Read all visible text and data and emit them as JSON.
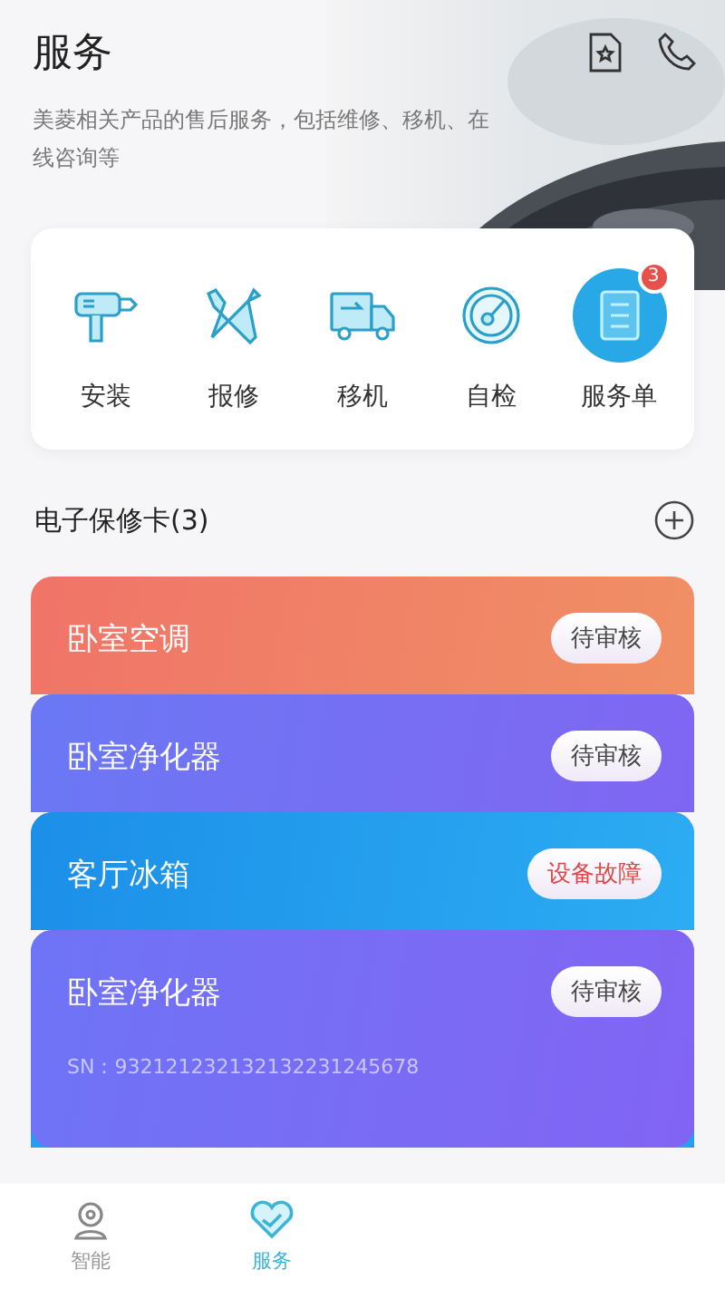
{
  "header": {
    "title": "服务",
    "description": "美菱相关产品的售后服务，包括维修、移机、在线咨询等"
  },
  "services": [
    {
      "kind": "install",
      "label": "安装",
      "highlighted": false
    },
    {
      "kind": "repair",
      "label": "报修",
      "highlighted": false
    },
    {
      "kind": "move",
      "label": "移机",
      "highlighted": false
    },
    {
      "kind": "check",
      "label": "自检",
      "highlighted": false
    },
    {
      "kind": "order",
      "label": "服务单",
      "highlighted": true,
      "badge": "3"
    }
  ],
  "warranty": {
    "title": "电子保修卡(3)",
    "cards": [
      {
        "name": "卧室空调",
        "status": "待审核",
        "fault": false,
        "color": "#f07468"
      },
      {
        "name": "卧室净化器",
        "status": "待审核",
        "fault": false,
        "color": "#6a78f4"
      },
      {
        "name": "客厅冰箱",
        "status": "设备故障",
        "fault": true,
        "color": "#1c8fe8"
      },
      {
        "name": "卧室净化器",
        "status": "待审核",
        "fault": false,
        "color": "#6e74f6",
        "sn": "SN：932121232132132231245678"
      }
    ]
  },
  "tabs": [
    {
      "label": "智能",
      "kind": "smart",
      "selected": false
    },
    {
      "label": "服务",
      "kind": "service",
      "selected": true
    }
  ]
}
